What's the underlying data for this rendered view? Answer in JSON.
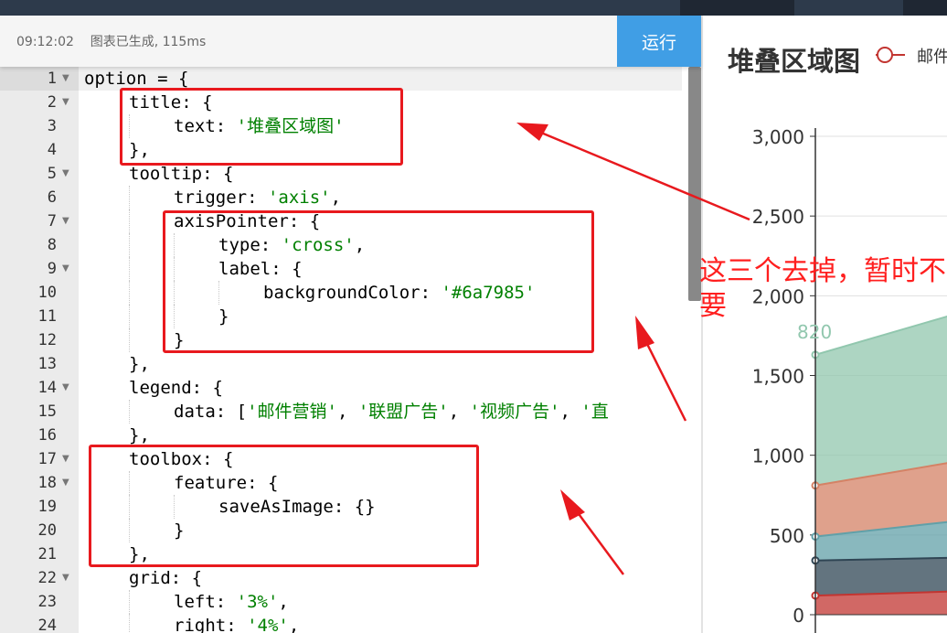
{
  "status": {
    "time": "09:12:02",
    "message": "图表已生成, 115ms"
  },
  "run_button": "运行",
  "code_lines": [
    {
      "n": "1",
      "fold": true,
      "indent": 0,
      "parts": [
        [
          "option = {",
          "plain"
        ]
      ]
    },
    {
      "n": "2",
      "fold": true,
      "indent": 1,
      "parts": [
        [
          "title: {",
          "plain"
        ]
      ]
    },
    {
      "n": "3",
      "fold": false,
      "indent": 2,
      "parts": [
        [
          "text: ",
          "plain"
        ],
        [
          "'堆叠区域图'",
          "str"
        ]
      ]
    },
    {
      "n": "4",
      "fold": false,
      "indent": 1,
      "parts": [
        [
          "},",
          "plain"
        ]
      ]
    },
    {
      "n": "5",
      "fold": true,
      "indent": 1,
      "parts": [
        [
          "tooltip: {",
          "plain"
        ]
      ]
    },
    {
      "n": "6",
      "fold": false,
      "indent": 2,
      "parts": [
        [
          "trigger: ",
          "plain"
        ],
        [
          "'axis'",
          "str"
        ],
        [
          ",",
          "plain"
        ]
      ]
    },
    {
      "n": "7",
      "fold": true,
      "indent": 2,
      "parts": [
        [
          "axisPointer: {",
          "plain"
        ]
      ]
    },
    {
      "n": "8",
      "fold": false,
      "indent": 3,
      "parts": [
        [
          "type: ",
          "plain"
        ],
        [
          "'cross'",
          "str"
        ],
        [
          ",",
          "plain"
        ]
      ]
    },
    {
      "n": "9",
      "fold": true,
      "indent": 3,
      "parts": [
        [
          "label: {",
          "plain"
        ]
      ]
    },
    {
      "n": "10",
      "fold": false,
      "indent": 4,
      "parts": [
        [
          "backgroundColor: ",
          "plain"
        ],
        [
          "'#6a7985'",
          "str"
        ]
      ]
    },
    {
      "n": "11",
      "fold": false,
      "indent": 3,
      "parts": [
        [
          "}",
          "plain"
        ]
      ]
    },
    {
      "n": "12",
      "fold": false,
      "indent": 2,
      "parts": [
        [
          "}",
          "plain"
        ]
      ]
    },
    {
      "n": "13",
      "fold": false,
      "indent": 1,
      "parts": [
        [
          "},",
          "plain"
        ]
      ]
    },
    {
      "n": "14",
      "fold": true,
      "indent": 1,
      "parts": [
        [
          "legend: {",
          "plain"
        ]
      ]
    },
    {
      "n": "15",
      "fold": false,
      "indent": 2,
      "parts": [
        [
          "data: [",
          "plain"
        ],
        [
          "'邮件营销'",
          "str"
        ],
        [
          ", ",
          "plain"
        ],
        [
          "'联盟广告'",
          "str"
        ],
        [
          ", ",
          "plain"
        ],
        [
          "'视频广告'",
          "str"
        ],
        [
          ", ",
          "plain"
        ],
        [
          "'直",
          "str"
        ]
      ]
    },
    {
      "n": "16",
      "fold": false,
      "indent": 1,
      "parts": [
        [
          "},",
          "plain"
        ]
      ]
    },
    {
      "n": "17",
      "fold": true,
      "indent": 1,
      "parts": [
        [
          "toolbox: {",
          "plain"
        ]
      ]
    },
    {
      "n": "18",
      "fold": true,
      "indent": 2,
      "parts": [
        [
          "feature: {",
          "plain"
        ]
      ]
    },
    {
      "n": "19",
      "fold": false,
      "indent": 3,
      "parts": [
        [
          "saveAsImage: {}",
          "plain"
        ]
      ]
    },
    {
      "n": "20",
      "fold": false,
      "indent": 2,
      "parts": [
        [
          "}",
          "plain"
        ]
      ]
    },
    {
      "n": "21",
      "fold": false,
      "indent": 1,
      "parts": [
        [
          "},",
          "plain"
        ]
      ]
    },
    {
      "n": "22",
      "fold": true,
      "indent": 1,
      "parts": [
        [
          "grid: {",
          "plain"
        ]
      ]
    },
    {
      "n": "23",
      "fold": false,
      "indent": 2,
      "parts": [
        [
          "left: ",
          "plain"
        ],
        [
          "'3%'",
          "str"
        ],
        [
          ",",
          "plain"
        ]
      ]
    },
    {
      "n": "24",
      "fold": false,
      "indent": 2,
      "parts": [
        [
          "right: ",
          "plain"
        ],
        [
          "'4%'",
          "str"
        ],
        [
          ",",
          "plain"
        ]
      ]
    }
  ],
  "preview": {
    "title": "堆叠区域图",
    "legend_label": "邮件",
    "annotation": "这三个去掉，暂时不需要"
  },
  "chart_data": {
    "type": "area",
    "title": "堆叠区域图",
    "yticks": [
      "0",
      "500",
      "1,000",
      "1,500",
      "2,000",
      "2,500",
      "3,000"
    ],
    "ylim": [
      0,
      3000
    ],
    "data_label": "820",
    "series": [
      {
        "color": "#c23531",
        "values": [
          120,
          150
        ]
      },
      {
        "color": "#2f4554",
        "values": [
          220,
          210
        ]
      },
      {
        "color": "#61a0a8",
        "values": [
          150,
          240
        ]
      },
      {
        "color": "#d48265",
        "values": [
          320,
          380
        ]
      },
      {
        "color": "#91c7ae",
        "values": [
          820,
          940
        ]
      }
    ]
  },
  "colors": {
    "run_button": "#409ee5",
    "annotation": "#e8191e",
    "string": "#008000"
  }
}
